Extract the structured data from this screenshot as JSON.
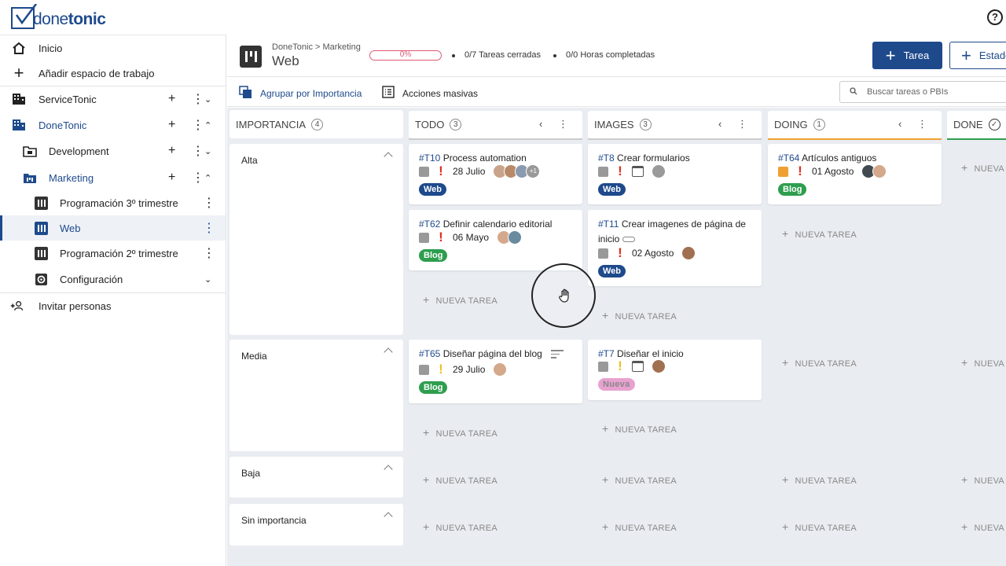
{
  "app": {
    "logo_text_light": "done",
    "logo_text_bold": "tonic",
    "help_label": "?"
  },
  "sidebar": {
    "inicio": "Inicio",
    "add_workspace": "Añadir espacio de trabajo",
    "servicetonic": "ServiceTonic",
    "donetonic": "DoneTonic",
    "development": "Development",
    "marketing": "Marketing",
    "programacion3": "Programación 3º trimestre",
    "web": "Web",
    "programacion2": "Programación 2º trimestre",
    "configuracion": "Configuración",
    "invitar": "Invitar personas"
  },
  "header": {
    "breadcrumb": "DoneTonic > Marketing",
    "title": "Web",
    "progress_label": "0%",
    "progress": 0,
    "tasks_closed": "0/7 Tareas cerradas",
    "hours": "0/0 Horas completadas",
    "btn_tarea": "Tarea",
    "btn_estado": "Estado",
    "plus": "+"
  },
  "toolbar": {
    "group_by": "Agrupar por Importancia",
    "bulk": "Acciones masivas",
    "search_placeholder": "Buscar tareas o PBIs"
  },
  "board": {
    "importance_header": "IMPORTANCIA",
    "importance_count": "4",
    "columns": [
      {
        "name": "TODO",
        "count": "3",
        "color": "#cccccc"
      },
      {
        "name": "IMAGES",
        "count": "3",
        "color": "#cccccc"
      },
      {
        "name": "DOING",
        "count": "1",
        "color": "#f0a030"
      },
      {
        "name": "DONE",
        "count": "",
        "color": "#2e9e4e"
      }
    ],
    "lanes": [
      "Alta",
      "Media",
      "Baja",
      "Sin importancia"
    ],
    "new_task": "NUEVA TAREA",
    "cards": [
      {
        "id": "#T10",
        "title": "Process automation",
        "date": "28 Julio",
        "tag": "Web",
        "more": "+1"
      },
      {
        "id": "#T62",
        "title": "Definir calendario editorial",
        "date": "06 Mayo",
        "tag": "Blog"
      },
      {
        "id": "#T65",
        "title": "Diseñar página del blog",
        "date": "29 Julio",
        "tag": "Blog"
      },
      {
        "id": "#T8",
        "title": "Crear formularios",
        "date": "",
        "tag": "Web"
      },
      {
        "id": "#T11",
        "title": "Crear imagenes de página de inicio",
        "date": "02 Agosto",
        "tag": "Web"
      },
      {
        "id": "#T7",
        "title": "Diseñar el inicio",
        "date": "",
        "tag": "Nueva"
      },
      {
        "id": "#T64",
        "title": "Artículos antiguos",
        "date": "01 Agosto",
        "tag": "Blog"
      }
    ]
  },
  "colors": {
    "brand": "#1e4a8c",
    "progress": "#e05a73",
    "tag_blog": "#2e9e4e",
    "tag_nueva": "#e8a2d0"
  }
}
